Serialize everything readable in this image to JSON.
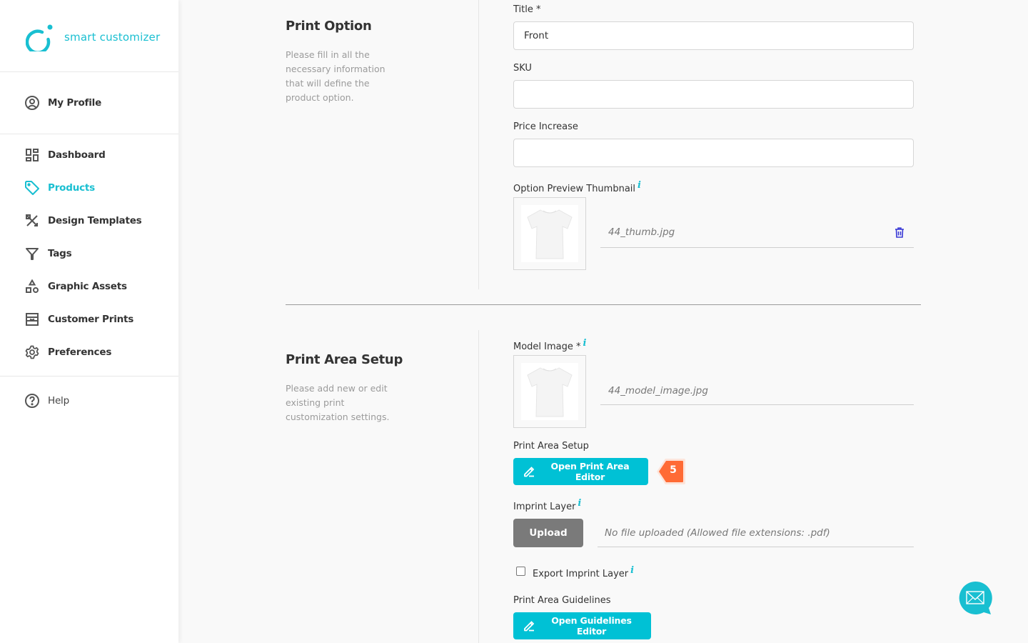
{
  "brand": {
    "name": "smart customizer",
    "color": "#19bfd1"
  },
  "sidebar": {
    "profile": {
      "label": "My Profile",
      "icon": "user-circle-icon"
    },
    "items": [
      {
        "label": "Dashboard",
        "icon": "dashboard-icon",
        "active": false
      },
      {
        "label": "Products",
        "icon": "tag-icon",
        "active": true
      },
      {
        "label": "Design Templates",
        "icon": "design-tools-icon",
        "active": false
      },
      {
        "label": "Tags",
        "icon": "filter-icon",
        "active": false
      },
      {
        "label": "Graphic Assets",
        "icon": "shapes-icon",
        "active": false
      },
      {
        "label": "Customer Prints",
        "icon": "prints-icon",
        "active": false
      },
      {
        "label": "Preferences",
        "icon": "gear-icon",
        "active": false
      }
    ],
    "help": {
      "label": "Help",
      "icon": "question-circle-icon"
    }
  },
  "print_option": {
    "title": "Print Option",
    "description": "Please fill in all the necessary information that will define the product option.",
    "fields": {
      "title": {
        "label": "Title *",
        "value": "Front"
      },
      "sku": {
        "label": "SKU",
        "value": ""
      },
      "price_increase": {
        "label": "Price Increase",
        "value": ""
      },
      "thumbnail": {
        "label": "Option Preview Thumbnail",
        "file_name": "44_thumb.jpg"
      }
    }
  },
  "print_area_setup": {
    "title": "Print Area Setup",
    "description": "Please add new or edit existing print customization settings.",
    "model_image": {
      "label": "Model Image *",
      "file_name": "44_model_image.jpg"
    },
    "setup": {
      "label": "Print Area Setup",
      "button": "Open Print Area Editor",
      "badge": "5"
    },
    "imprint_layer": {
      "label": "Imprint Layer",
      "upload_button": "Upload",
      "status": "No file uploaded (Allowed file extensions: .pdf)"
    },
    "export_imprint": {
      "label": "Export Imprint Layer",
      "checked": false
    },
    "guidelines": {
      "label": "Print Area Guidelines",
      "button": "Open Guidelines Editor"
    }
  },
  "colors": {
    "accent": "#00c1d5",
    "badge": "#ff6b35",
    "upload_button": "#7a7a7a",
    "delete_icon": "#3a3ad6"
  }
}
